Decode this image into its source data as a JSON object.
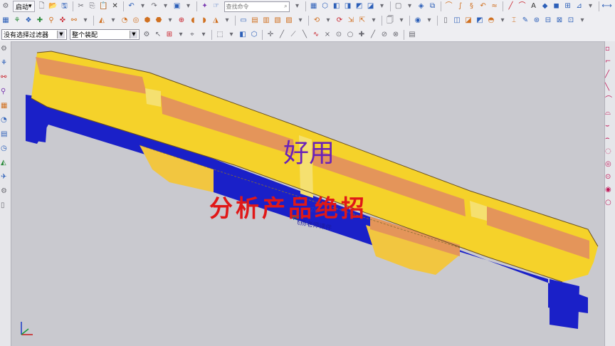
{
  "toolbar1": {
    "start_menu_label": "启动",
    "search": {
      "placeholder": "查找命令"
    }
  },
  "toolbar2": {},
  "toolbar3": {
    "filter_select": {
      "value": "没有选择过滤器"
    },
    "scope_select": {
      "value": "整个装配"
    }
  },
  "viewport": {
    "caption_top": "好用",
    "caption_main": "分析产品绝招",
    "watermark": "飞扬老师课件",
    "axis_zc": "ZC",
    "axis_yc": "YC"
  },
  "icons": {
    "part_colors": {
      "top_face": "#f5d22a",
      "slope_face": "#e4955a",
      "side_face": "#1a20c8",
      "edge_line": "#6a5020"
    }
  }
}
